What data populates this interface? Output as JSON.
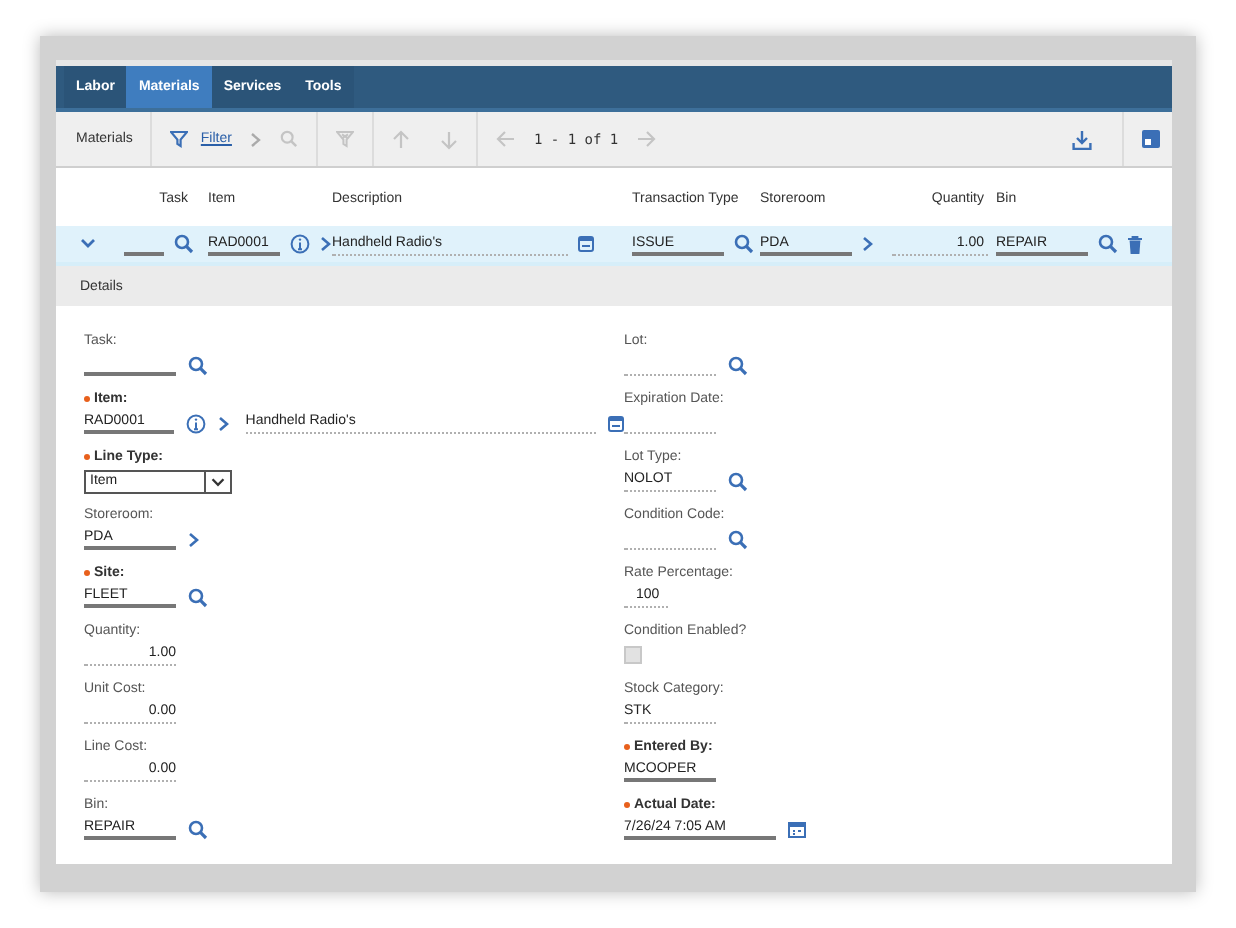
{
  "tabs": [
    {
      "label": "Labor",
      "selected": false
    },
    {
      "label": "Materials",
      "selected": true
    },
    {
      "label": "Services",
      "selected": false
    },
    {
      "label": "Tools",
      "selected": false
    }
  ],
  "toolbar": {
    "title": "Materials",
    "filter_link": "Filter",
    "pagination": "1 - 1 of 1"
  },
  "table": {
    "columns": [
      "Task",
      "Item",
      "Description",
      "Transaction Type",
      "Storeroom",
      "Quantity",
      "Bin"
    ],
    "rows": [
      {
        "expanded": true,
        "item": "RAD0001",
        "description": "Handheld Radio's",
        "transaction_type": "ISSUE",
        "storeroom": "PDA",
        "quantity": "1.00",
        "bin": "REPAIR"
      }
    ]
  },
  "details": {
    "title": "Details",
    "left": [
      {
        "kind": "lookup",
        "label": "Task:",
        "required": false,
        "readonly": false
      },
      {
        "kind": "item",
        "label": "Item:",
        "required": true,
        "readonly": false,
        "value": "RAD0001",
        "description": "Handheld Radio's"
      },
      {
        "kind": "select",
        "label": "Line Type:",
        "required": true,
        "value": "Item"
      },
      {
        "kind": "link",
        "label": "Storeroom:",
        "required": false,
        "readonly": false,
        "value": "PDA"
      },
      {
        "kind": "lookup",
        "label": "Site:",
        "required": true,
        "readonly": false,
        "value": "FLEET"
      },
      {
        "kind": "number",
        "label": "Quantity:",
        "required": false,
        "readonly": true,
        "value": "1.00"
      },
      {
        "kind": "number",
        "label": "Unit Cost:",
        "required": false,
        "readonly": true,
        "value": "0.00"
      },
      {
        "kind": "number",
        "label": "Line Cost:",
        "required": false,
        "readonly": true,
        "value": "0.00"
      },
      {
        "kind": "lookup",
        "label": "Bin:",
        "required": false,
        "readonly": false,
        "value": "REPAIR"
      }
    ],
    "right": [
      {
        "kind": "lookup",
        "label": "Lot:",
        "required": false,
        "readonly": true
      },
      {
        "kind": "text",
        "label": "Expiration Date:",
        "required": false,
        "readonly": true
      },
      {
        "kind": "lookup",
        "label": "Lot Type:",
        "required": false,
        "readonly": true,
        "value": "NOLOT"
      },
      {
        "kind": "lookup",
        "label": "Condition Code:",
        "required": false,
        "readonly": true
      },
      {
        "kind": "short",
        "label": "Rate Percentage:",
        "required": false,
        "readonly": true,
        "value": "100"
      },
      {
        "kind": "checkbox",
        "label": "Condition Enabled?",
        "required": false,
        "checked": false,
        "disabled": true
      },
      {
        "kind": "text",
        "label": "Stock Category:",
        "required": false,
        "readonly": true,
        "value": "STK"
      },
      {
        "kind": "text",
        "label": "Entered By:",
        "required": true,
        "readonly": false,
        "value": "MCOOPER"
      },
      {
        "kind": "date",
        "label": "Actual Date:",
        "required": true,
        "readonly": false,
        "value": "7/26/24 7:05 AM"
      }
    ]
  }
}
